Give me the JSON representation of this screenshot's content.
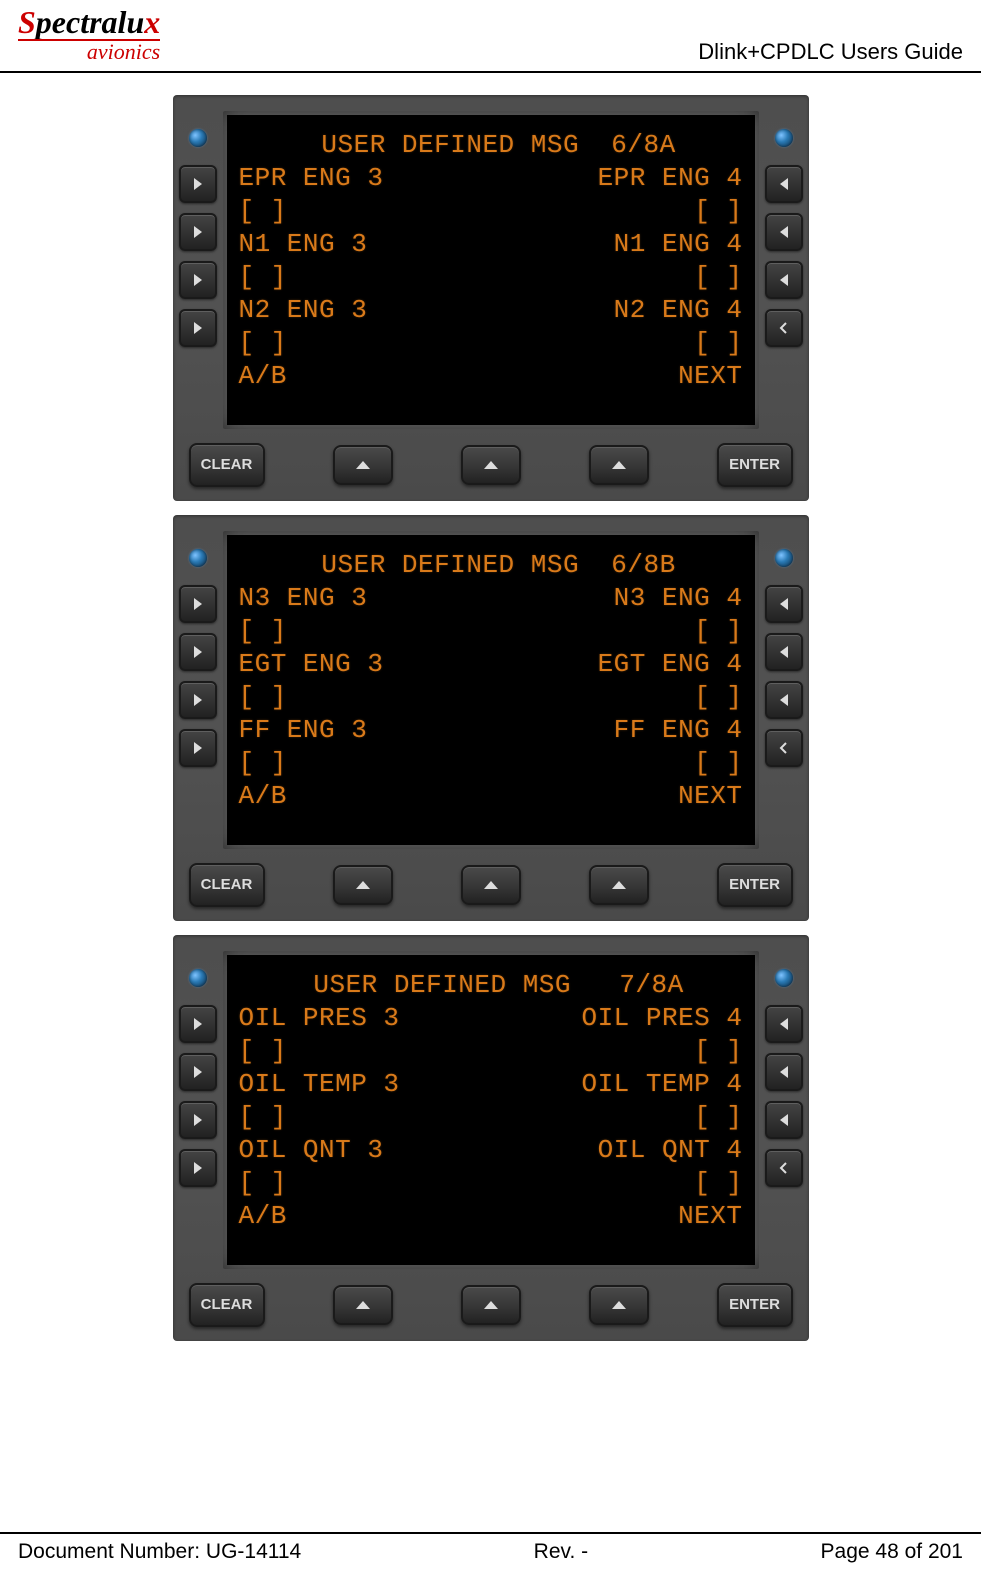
{
  "header": {
    "logo_main": "Spectralux",
    "logo_sub": "avionics",
    "title": "Dlink+CPDLC Users Guide"
  },
  "screens": [
    {
      "title": " USER DEFINED MSG  6/8A",
      "rows": [
        {
          "l": "EPR ENG 3",
          "r": "EPR ENG 4"
        },
        {
          "l": "[ ]",
          "r": "[ ]"
        },
        {
          "l": "N1 ENG 3",
          "r": "N1 ENG 4"
        },
        {
          "l": "[ ]",
          "r": "[ ]"
        },
        {
          "l": "N2 ENG 3",
          "r": "N2 ENG 4"
        },
        {
          "l": "[ ]",
          "r": "[ ]"
        },
        {
          "l": "",
          "r": ""
        },
        {
          "l": "A/B",
          "r": "NEXT"
        }
      ]
    },
    {
      "title": " USER DEFINED MSG  6/8B",
      "rows": [
        {
          "l": "N3 ENG 3",
          "r": "N3 ENG 4"
        },
        {
          "l": "[ ]",
          "r": "[ ]"
        },
        {
          "l": "EGT ENG 3",
          "r": "EGT ENG 4"
        },
        {
          "l": "[ ]",
          "r": "[ ]"
        },
        {
          "l": "FF ENG 3",
          "r": "FF ENG 4"
        },
        {
          "l": "[ ]",
          "r": "[ ]"
        },
        {
          "l": "",
          "r": ""
        },
        {
          "l": "A/B",
          "r": "NEXT"
        }
      ]
    },
    {
      "title": " USER DEFINED MSG   7/8A",
      "rows": [
        {
          "l": "OIL PRES 3",
          "r": "OIL PRES 4"
        },
        {
          "l": "[ ]",
          "r": "[ ]"
        },
        {
          "l": "OIL TEMP 3",
          "r": "OIL TEMP 4"
        },
        {
          "l": "[ ]",
          "r": "[ ]"
        },
        {
          "l": "OIL QNT 3",
          "r": "OIL QNT 4"
        },
        {
          "l": "[ ]",
          "r": "[ ]"
        },
        {
          "l": "",
          "r": ""
        },
        {
          "l": "A/B",
          "r": "NEXT"
        }
      ]
    }
  ],
  "keys": {
    "clear": "CLEAR",
    "enter": "ENTER"
  },
  "footer": {
    "doc_label": "Document Number:  UG-14114",
    "rev": "Rev. -",
    "page": "Page 48 of 201"
  }
}
